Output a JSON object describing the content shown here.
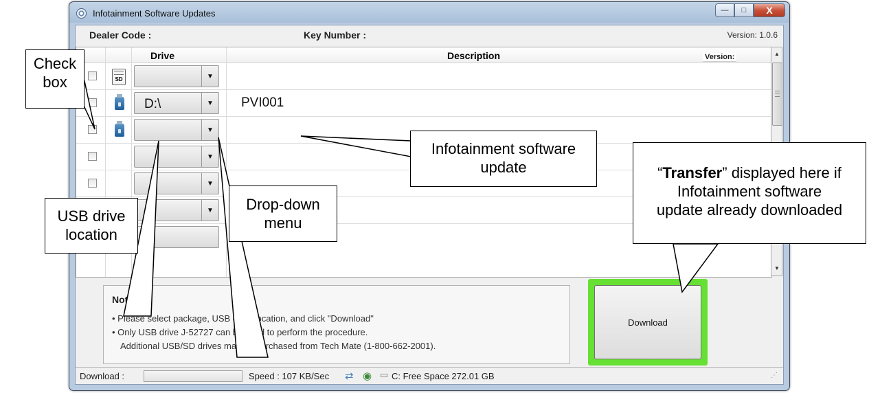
{
  "window": {
    "title": "Infotainment Software Updates",
    "buttons": {
      "minimize": "—",
      "maximize": "□",
      "close": "X"
    }
  },
  "header": {
    "dealer_code_label": "Dealer Code :",
    "key_number_label": "Key Number :",
    "version": "Version: 1.0.6"
  },
  "grid": {
    "columns": [
      "Drive",
      "Description"
    ],
    "version_label": "Version:",
    "rows": [
      {
        "icon": "sd-card-icon",
        "sd_label": "SD",
        "drive": "",
        "description": ""
      },
      {
        "icon": "usb-drive-icon",
        "drive": "D:\\",
        "description": "PVI001"
      },
      {
        "icon": "usb-drive-icon",
        "drive": "",
        "description": ""
      },
      {
        "icon": "",
        "drive": "",
        "description": ""
      },
      {
        "icon": "",
        "drive": "",
        "description": ""
      },
      {
        "icon": "usb-drive-icon",
        "drive": "",
        "description": ""
      }
    ]
  },
  "note": {
    "title": "Note:",
    "lines": [
      "• Please select package, USB drive location, and click \"Download\"",
      "• Only USB drive J-52727 can be used to perform the procedure.",
      "Additional USB/SD drives may be purchased from Tech Mate (1-800-662-2001)."
    ]
  },
  "download_button": "Download",
  "status": {
    "download_label": "Download :",
    "download_progress": 0,
    "speed": "Speed : 107 KB/Sec",
    "free_space": "C: Free Space 272.01 GB"
  },
  "callouts": {
    "check_box": [
      "Check",
      "box"
    ],
    "usb_location": [
      "USB drive",
      "location"
    ],
    "dropdown": [
      "Drop-down",
      "menu"
    ],
    "software_update": [
      "Infotainment software",
      "update"
    ],
    "transfer_prefix": "“",
    "transfer_word": "Transfer",
    "transfer_suffix": "” displayed here if",
    "transfer_lines": [
      "Infotainment software",
      "update already downloaded"
    ]
  }
}
